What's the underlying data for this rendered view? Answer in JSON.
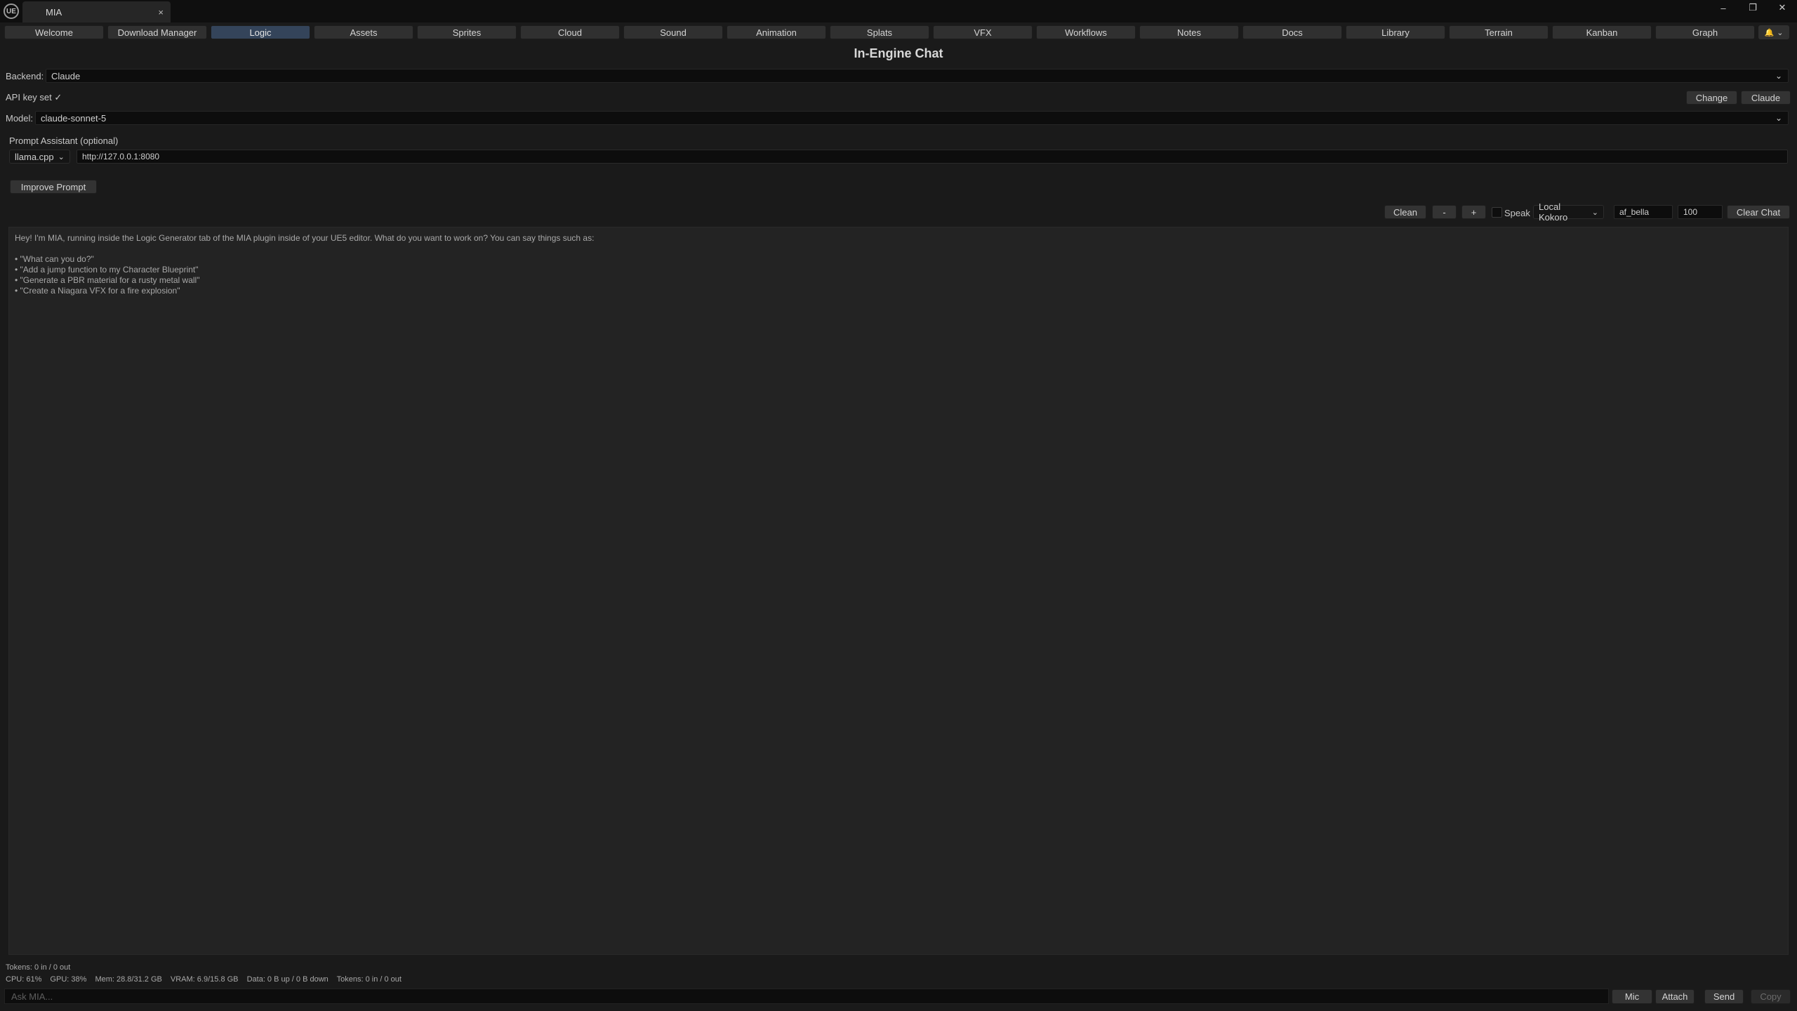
{
  "window": {
    "app_logo": "UE",
    "tab_title": "MIA",
    "close_glyph": "×",
    "controls": [
      "–",
      "❐",
      "✕"
    ]
  },
  "tabs": [
    {
      "label": "Welcome",
      "active": false
    },
    {
      "label": "Download Manager",
      "active": false
    },
    {
      "label": "Logic",
      "active": true
    },
    {
      "label": "Assets",
      "active": false
    },
    {
      "label": "Sprites",
      "active": false
    },
    {
      "label": "Cloud",
      "active": false
    },
    {
      "label": "Sound",
      "active": false
    },
    {
      "label": "Animation",
      "active": false
    },
    {
      "label": "Splats",
      "active": false
    },
    {
      "label": "VFX",
      "active": false
    },
    {
      "label": "Workflows",
      "active": false
    },
    {
      "label": "Notes",
      "active": false
    },
    {
      "label": "Docs",
      "active": false
    },
    {
      "label": "Library",
      "active": false
    },
    {
      "label": "Terrain",
      "active": false
    },
    {
      "label": "Kanban",
      "active": false
    },
    {
      "label": "Graph",
      "active": false
    }
  ],
  "notifications": {
    "icon": "bell-icon",
    "glyph": "🔔"
  },
  "page_title": "In-Engine Chat",
  "backend": {
    "label": "Backend:",
    "value": "Claude"
  },
  "api_key": {
    "status": "API key set ✓",
    "change_label": "Change",
    "provider_label": "Claude"
  },
  "model": {
    "label": "Model:",
    "value": "claude-sonnet-5"
  },
  "prompt_assistant": {
    "label": "Prompt Assistant (optional)",
    "engine": "llama.cpp",
    "url": "http://127.0.0.1:8080",
    "improve_label": "Improve Prompt"
  },
  "chat_toolbar": {
    "clean_label": "Clean",
    "minus_label": "-",
    "plus_label": "+",
    "speak_label": "Speak",
    "voice_engine": "Local Kokoro",
    "voice_name": "af_bella",
    "volume": "100",
    "clear_label": "Clear Chat"
  },
  "chat": {
    "greeting": "Hey! I'm MIA, running inside the Logic Generator tab of the MIA plugin inside of your UE5 editor. What do you want to work on? You can say things such as:",
    "suggestions": [
      "• \"What can you do?\"",
      "• \"Add a jump function to my Character Blueprint\"",
      "• \"Generate a PBR material for a rusty metal wall\"",
      "• \"Create a Niagara VFX for a fire explosion\""
    ]
  },
  "status": {
    "tokens": "Tokens: 0 in / 0 out",
    "cpu": "CPU: 61%",
    "gpu": "GPU: 38%",
    "mem": "Mem: 28.8/31.2 GB",
    "vram": "VRAM: 6.9/15.8 GB",
    "data": "Data: 0 B up / 0 B down",
    "tokens2": "Tokens: 0 in / 0 out"
  },
  "input": {
    "placeholder": "Ask MIA...",
    "mic_label": "Mic",
    "attach_label": "Attach",
    "send_label": "Send",
    "copy_label": "Copy"
  },
  "colors": {
    "active_tab": "#34445a",
    "background": "#1a1a1a",
    "chat_bg": "#232323"
  }
}
